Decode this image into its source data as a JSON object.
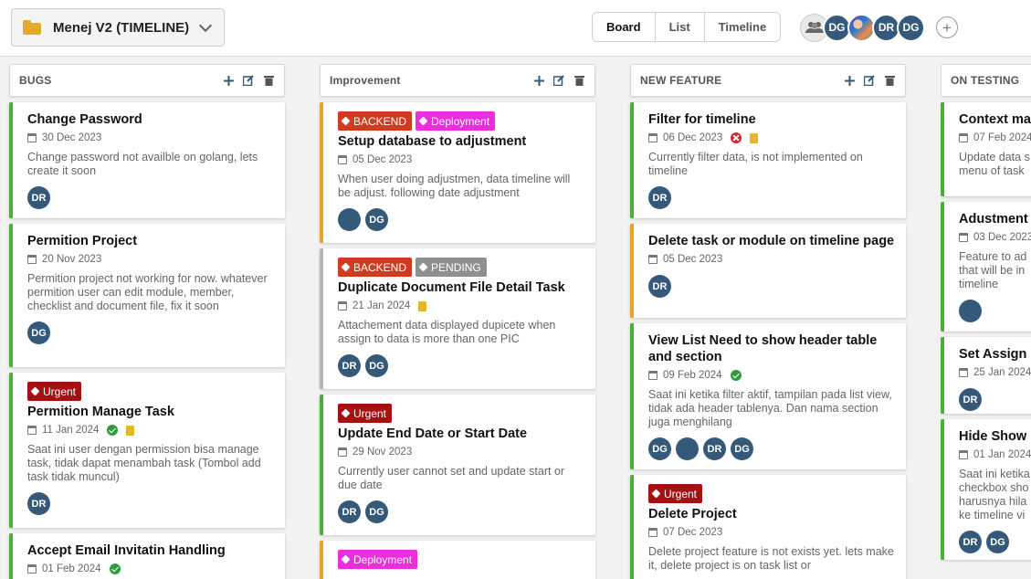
{
  "header": {
    "project_name": "Menej V2 (TIMELINE)",
    "view_tabs": [
      "Board",
      "List",
      "Timeline"
    ],
    "active_tab": "Board",
    "members": [
      "DG",
      "photo",
      "DR",
      "DG"
    ],
    "add_member_label": "+"
  },
  "columns": [
    {
      "title": "BUGS",
      "cards": [
        {
          "title": "Change Password",
          "date": "30 Dec 2023",
          "desc": "Change password not availble on golang, lets create it soon",
          "people": [
            "DR"
          ]
        },
        {
          "title": "Permition Project",
          "date": "20 Nov 2023",
          "desc": "Permition project not working for now. whatever permition user can edit module, member, checklist and document file, fix it soon",
          "people": [
            "DG"
          ]
        },
        {
          "tags": [
            "Urgent"
          ],
          "title": "Permition Manage Task",
          "date": "11 Jan 2024",
          "desc": "Saat ini user dengan permission bisa manage task, tidak dapat menambah task (Tombol add task tidak muncul)",
          "people": [
            "DR"
          ]
        },
        {
          "title": "Accept Email Invitatin Handling",
          "date": "01 Feb 2024"
        }
      ]
    },
    {
      "title": "Improvement",
      "cards": [
        {
          "tags": [
            "BACKEND",
            "Deployment"
          ],
          "title": "Setup database to adjustment",
          "date": "05 Dec 2023",
          "desc": "When user doing adjustmen, data timeline will be adjust. following date adjustment",
          "people": [
            "photo",
            "DG"
          ]
        },
        {
          "tags": [
            "BACKEND",
            "PENDING"
          ],
          "title": "Duplicate Document File Detail Task",
          "date": "21 Jan 2024",
          "desc": "Attachement data displayed dupicete when assign to data is more than one PIC",
          "people": [
            "DR",
            "DG"
          ]
        },
        {
          "tags": [
            "Urgent"
          ],
          "title": "Update End Date or Start Date",
          "date": "29 Nov 2023",
          "desc": "Currently user cannot set and update start or due date",
          "people": [
            "DR",
            "DG"
          ]
        },
        {
          "tags": [
            "Deployment"
          ]
        }
      ]
    },
    {
      "title": "NEW FEATURE",
      "cards": [
        {
          "title": "Filter for timeline",
          "date": "06 Dec 2023",
          "desc": "Currently filter data, is not implemented on timeline",
          "people": [
            "DR"
          ]
        },
        {
          "title": "Delete task or module on timeline page",
          "date": "05 Dec 2023",
          "people": [
            "DR"
          ]
        },
        {
          "title": "View List Need to show header table and section",
          "date": "09 Feb 2024",
          "desc": "Saat ini ketika filter aktif, tampilan pada list view, tidak ada header tablenya. Dan nama section juga menghilang",
          "people": [
            "DG",
            "photo",
            "DR",
            "DG"
          ]
        },
        {
          "tags": [
            "Urgent"
          ],
          "title": "Delete Project",
          "date": "07 Dec 2023",
          "desc": "Delete project feature is not exists yet. lets make it, delete project is on task list or"
        }
      ]
    },
    {
      "title": "ON TESTING",
      "cards": [
        {
          "title": "Context ma",
          "date": "07 Feb 2024",
          "desc": "Update data s menu of task"
        },
        {
          "title": "Adustment",
          "date": "03 Dec 2023",
          "desc": "Feature to ad that will be in timeline",
          "people": [
            "photo"
          ]
        },
        {
          "title": "Set Assign",
          "date": "25 Jan 2024",
          "people": [
            "DR"
          ]
        },
        {
          "title": "Hide Show",
          "date": "01 Jan 2024",
          "desc": "Saat ini ketika checkbox sho harusnya hila ke timeline vi",
          "people": [
            "DR",
            "DG"
          ]
        }
      ]
    }
  ]
}
